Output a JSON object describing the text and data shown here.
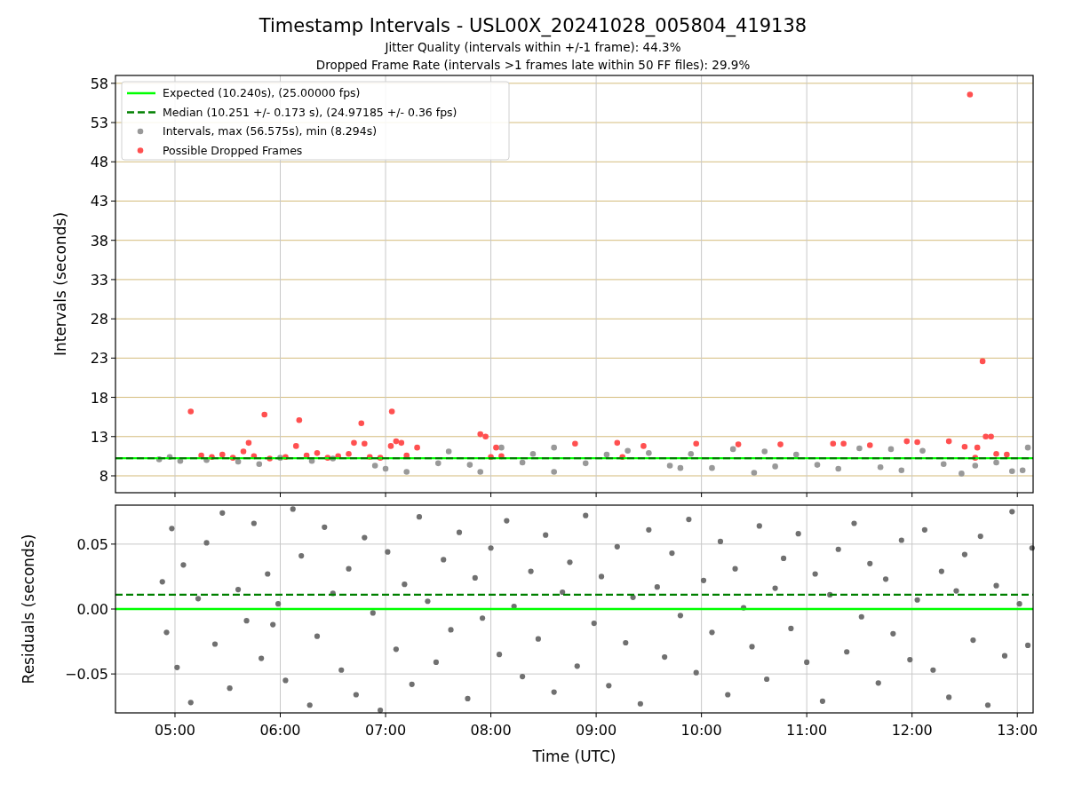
{
  "figure": {
    "title": "Timestamp Intervals - USL00X_20241028_005804_419138",
    "subtitles": [
      "Jitter Quality (intervals within +/-1 frame): 44.3%",
      "Dropped Frame Rate (intervals >1 frames late within 50 FF files): 29.9%"
    ]
  },
  "intervals_plot": {
    "chart_data": {
      "type": "scatter",
      "grid": true,
      "legend": true,
      "ylabel": "Intervals (seconds)",
      "xlim": [
        4.435,
        13.15
      ],
      "ylim": [
        5.85,
        59.0
      ],
      "yticks": [
        {
          "value": 8,
          "label": "8"
        },
        {
          "value": 13,
          "label": "13"
        },
        {
          "value": 18,
          "label": "18"
        },
        {
          "value": 23,
          "label": "23"
        },
        {
          "value": 28,
          "label": "28"
        },
        {
          "value": 33,
          "label": "33"
        },
        {
          "value": 38,
          "label": "38"
        },
        {
          "value": 43,
          "label": "43"
        },
        {
          "value": 48,
          "label": "48"
        },
        {
          "value": 53,
          "label": "53"
        },
        {
          "value": 58,
          "label": "58"
        }
      ],
      "series": [
        {
          "name": "Expected (10.240s), (25.00000 fps)",
          "type": "line",
          "line_style": "solid",
          "color": "#00ff00",
          "x": [
            4.435,
            13.15
          ],
          "values": [
            10.24,
            10.24
          ]
        },
        {
          "name": "Median (10.251 +/- 0.173 s), (24.97185 +/- 0.36 fps)",
          "type": "line",
          "line_style": "dashed",
          "color": "#008000",
          "x": [
            4.435,
            13.15
          ],
          "values": [
            10.251,
            10.251
          ]
        },
        {
          "name": "Intervals, max (56.575s), min (8.294s)",
          "type": "scatter",
          "color": "#999999",
          "x": [
            4.85,
            4.95,
            5.05,
            5.3,
            5.6,
            5.8,
            6.0,
            6.3,
            6.5,
            6.9,
            7.0,
            7.2,
            7.5,
            7.6,
            7.8,
            7.9,
            8.1,
            8.3,
            8.4,
            8.6,
            8.6,
            8.9,
            9.1,
            9.3,
            9.5,
            9.7,
            9.8,
            9.9,
            10.1,
            10.3,
            10.5,
            10.6,
            10.7,
            10.9,
            11.1,
            11.3,
            11.5,
            11.7,
            11.8,
            11.9,
            12.1,
            12.3,
            12.47,
            12.6,
            12.8,
            12.95,
            13.05,
            13.1
          ],
          "values": [
            10.1,
            10.4,
            9.9,
            10.0,
            9.8,
            9.5,
            10.3,
            9.9,
            10.2,
            9.3,
            8.9,
            8.5,
            9.6,
            11.1,
            9.4,
            8.5,
            11.6,
            9.7,
            10.8,
            11.6,
            8.5,
            9.6,
            10.7,
            11.2,
            10.9,
            9.3,
            9.0,
            10.8,
            9.0,
            11.4,
            8.4,
            11.1,
            9.2,
            10.7,
            9.4,
            8.9,
            11.5,
            9.1,
            11.4,
            8.7,
            11.2,
            9.5,
            8.294,
            9.3,
            9.7,
            8.6,
            8.7,
            11.6
          ]
        },
        {
          "name": "Possible Dropped Frames",
          "type": "scatter",
          "color": "#ff5050",
          "x": [
            5.15,
            5.85,
            6.18,
            6.77,
            7.06,
            7.9,
            7.95,
            12.55,
            12.67,
            12.7,
            12.75,
            5.25,
            5.35,
            5.45,
            5.55,
            5.65,
            5.7,
            5.75,
            5.9,
            6.05,
            6.15,
            6.25,
            6.35,
            6.45,
            6.55,
            6.65,
            6.7,
            6.8,
            6.85,
            6.95,
            7.05,
            7.1,
            7.15,
            7.2,
            7.3,
            8.0,
            8.05,
            8.1,
            8.8,
            9.2,
            9.25,
            9.45,
            9.95,
            10.35,
            10.75,
            11.25,
            11.35,
            11.6,
            11.95,
            12.05,
            12.35,
            12.5,
            12.6,
            12.62,
            12.8,
            12.9
          ],
          "values": [
            16.2,
            15.8,
            15.1,
            14.7,
            16.2,
            13.3,
            13.0,
            56.575,
            22.6,
            13.0,
            13.0,
            10.6,
            10.4,
            10.7,
            10.3,
            11.1,
            12.2,
            10.5,
            10.2,
            10.4,
            11.8,
            10.6,
            10.9,
            10.3,
            10.5,
            10.8,
            12.2,
            12.1,
            10.4,
            10.3,
            11.8,
            12.4,
            12.2,
            10.6,
            11.6,
            10.4,
            11.6,
            10.5,
            12.1,
            12.2,
            10.4,
            11.8,
            12.1,
            12.0,
            12.0,
            12.1,
            12.1,
            11.9,
            12.4,
            12.3,
            12.4,
            11.7,
            10.3,
            11.6,
            10.8,
            10.7
          ]
        }
      ]
    }
  },
  "residuals_plot": {
    "chart_data": {
      "type": "scatter",
      "grid": true,
      "xlabel": "Time (UTC)",
      "ylabel": "Residuals (seconds)",
      "xlim": [
        4.435,
        13.15
      ],
      "ylim": [
        -0.08,
        0.08
      ],
      "xticks": [
        {
          "value": 5,
          "label": "05:00"
        },
        {
          "value": 6,
          "label": "06:00"
        },
        {
          "value": 7,
          "label": "07:00"
        },
        {
          "value": 8,
          "label": "08:00"
        },
        {
          "value": 9,
          "label": "09:00"
        },
        {
          "value": 10,
          "label": "10:00"
        },
        {
          "value": 11,
          "label": "11:00"
        },
        {
          "value": 12,
          "label": "12:00"
        },
        {
          "value": 13,
          "label": "13:00"
        }
      ],
      "yticks": [
        {
          "value": 0.05,
          "label": "0.05"
        },
        {
          "value": 0,
          "label": "0.00"
        },
        {
          "value": -0.05,
          "label": "−0.05"
        }
      ],
      "series": [
        {
          "type": "line",
          "line_style": "solid",
          "color": "#00ff00",
          "x": [
            4.435,
            13.15
          ],
          "values": [
            0,
            0
          ]
        },
        {
          "type": "line",
          "line_style": "dashed",
          "color": "#008000",
          "x": [
            4.435,
            13.15
          ],
          "values": [
            0.011,
            0.011
          ]
        },
        {
          "type": "scatter",
          "color": "#707070",
          "x": [
            4.88,
            4.92,
            4.97,
            5.02,
            5.08,
            5.15,
            5.22,
            5.3,
            5.38,
            5.45,
            5.52,
            5.6,
            5.68,
            5.75,
            5.82,
            5.88,
            5.93,
            5.98,
            6.05,
            6.12,
            6.2,
            6.28,
            6.35,
            6.42,
            6.5,
            6.58,
            6.65,
            6.72,
            6.8,
            6.88,
            6.95,
            7.02,
            7.1,
            7.18,
            7.25,
            7.32,
            7.4,
            7.48,
            7.55,
            7.62,
            7.7,
            7.78,
            7.85,
            7.92,
            8.0,
            8.08,
            8.15,
            8.22,
            8.3,
            8.38,
            8.45,
            8.52,
            8.6,
            8.68,
            8.75,
            8.82,
            8.9,
            8.98,
            9.05,
            9.12,
            9.2,
            9.28,
            9.35,
            9.42,
            9.5,
            9.58,
            9.65,
            9.72,
            9.8,
            9.88,
            9.95,
            10.02,
            10.1,
            10.18,
            10.25,
            10.32,
            10.4,
            10.48,
            10.55,
            10.62,
            10.7,
            10.78,
            10.85,
            10.92,
            11.0,
            11.08,
            11.15,
            11.22,
            11.3,
            11.38,
            11.45,
            11.52,
            11.6,
            11.68,
            11.75,
            11.82,
            11.9,
            11.98,
            12.05,
            12.12,
            12.2,
            12.28,
            12.35,
            12.42,
            12.5,
            12.58,
            12.65,
            12.72,
            12.8,
            12.88,
            12.95,
            13.02,
            13.1,
            13.14
          ],
          "values": [
            0.021,
            -0.018,
            0.062,
            -0.045,
            0.034,
            -0.072,
            0.008,
            0.051,
            -0.027,
            0.074,
            -0.061,
            0.015,
            -0.009,
            0.066,
            -0.038,
            0.027,
            -0.012,
            0.004,
            -0.055,
            0.077,
            0.041,
            -0.074,
            -0.021,
            0.063,
            0.012,
            -0.047,
            0.031,
            -0.066,
            0.055,
            -0.003,
            -0.078,
            0.044,
            -0.031,
            0.019,
            -0.058,
            0.071,
            0.006,
            -0.041,
            0.038,
            -0.016,
            0.059,
            -0.069,
            0.024,
            -0.007,
            0.047,
            -0.035,
            0.068,
            0.002,
            -0.052,
            0.029,
            -0.023,
            0.057,
            -0.064,
            0.013,
            0.036,
            -0.044,
            0.072,
            -0.011,
            0.025,
            -0.059,
            0.048,
            -0.026,
            0.009,
            -0.073,
            0.061,
            0.017,
            -0.037,
            0.043,
            -0.005,
            0.069,
            -0.049,
            0.022,
            -0.018,
            0.052,
            -0.066,
            0.031,
            0.001,
            -0.029,
            0.064,
            -0.054,
            0.016,
            0.039,
            -0.015,
            0.058,
            -0.041,
            0.027,
            -0.071,
            0.011,
            0.046,
            -0.033,
            0.066,
            -0.006,
            0.035,
            -0.057,
            0.023,
            -0.019,
            0.053,
            -0.039,
            0.007,
            0.061,
            -0.047,
            0.029,
            -0.068,
            0.014,
            0.042,
            -0.024,
            0.056,
            -0.074,
            0.018,
            -0.036,
            0.075,
            0.004,
            -0.028,
            0.047
          ]
        }
      ]
    }
  }
}
